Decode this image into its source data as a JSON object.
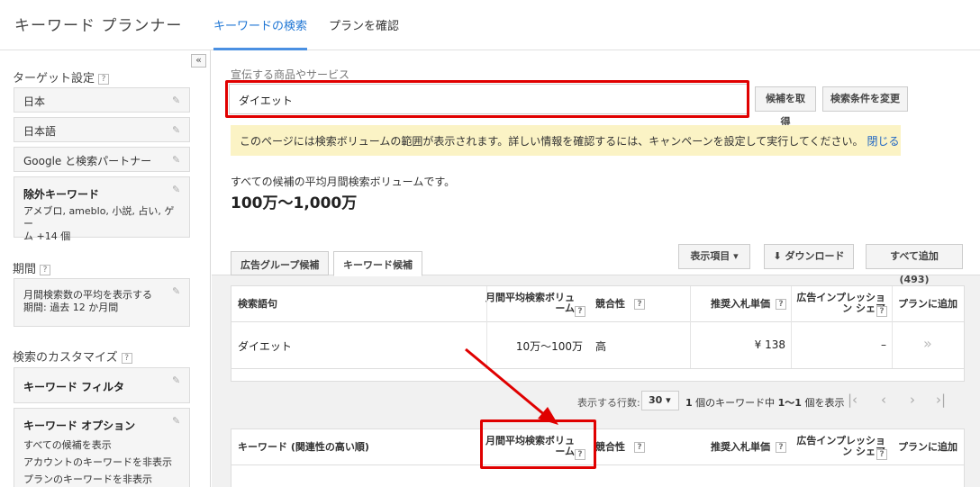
{
  "header": {
    "app_title": "キーワード プランナー",
    "tabs": [
      {
        "label": "キーワードの検索",
        "active": true
      },
      {
        "label": "プランを確認",
        "active": false
      }
    ]
  },
  "sidebar": {
    "collapse_label": "«",
    "targeting_title": "ターゲット設定",
    "targeting_items": [
      "日本",
      "日本語",
      "Google と検索パートナー"
    ],
    "negative": {
      "title": "除外キーワード",
      "line1": "アメブロ, ameblo, 小説, 占い, ゲー",
      "line2": "ム +14 個"
    },
    "period_title": "期間",
    "period": {
      "line1": "月間検索数の平均を表示する",
      "line2": "期間: 過去 12 か月間"
    },
    "customize_title": "検索のカスタマイズ",
    "keyword_filter": "キーワード フィルタ",
    "keyword_options": {
      "title": "キーワード オプション",
      "lines": [
        "すべての候補を表示",
        "アカウントのキーワードを非表示",
        "プランのキーワードを非表示"
      ]
    },
    "help": "?"
  },
  "main": {
    "product_label": "宣伝する商品やサービス",
    "search_value": "ダイエット",
    "get_ideas_label": "候補を取得",
    "modify_search_label": "検索条件を変更",
    "notice_text": "このページには検索ボリュームの範囲が表示されます。詳しい情報を確認するには、キャンペーンを設定して実行してください。",
    "notice_close": "閉じる",
    "avg_text": "すべての候補の平均月間検索ボリュームです。",
    "avg_value": "100万〜1,000万",
    "subtabs": [
      {
        "label": "広告グループ候補",
        "active": false
      },
      {
        "label": "キーワード候補",
        "active": true
      }
    ],
    "columns_label": "表示項目 ▾",
    "download_label": "ダウンロード",
    "add_all_label": "すべて追加 (493)",
    "table1": {
      "headers": [
        "検索語句",
        "月間平均検索ボリューム",
        "競合性",
        "推奨入札単価",
        "広告インプレッション シェア",
        "プランに追加"
      ],
      "row": {
        "term": "ダイエット",
        "volume": "10万〜100万",
        "competition": "高",
        "bid": "¥ 138",
        "share": "–",
        "add": "»"
      }
    },
    "pager": {
      "rows_label": "表示する行数:",
      "rows_value": "30 ▾",
      "status_pre": "1",
      "status_mid": "個のキーワード中",
      "status_range": "1〜1",
      "status_post": "個を表示",
      "first": "|‹",
      "prev": "‹",
      "next": "›",
      "last": "›|"
    },
    "table2": {
      "headers": [
        "キーワード (関連性の高い順)",
        "月間平均検索ボリューム",
        "競合性",
        "推奨入札単価",
        "広告インプレッション シェア",
        "プランに追加"
      ]
    }
  },
  "colors": {
    "accent": "#1f76d4",
    "highlight": "#e00000",
    "notice_bg": "#fbf3c5"
  }
}
